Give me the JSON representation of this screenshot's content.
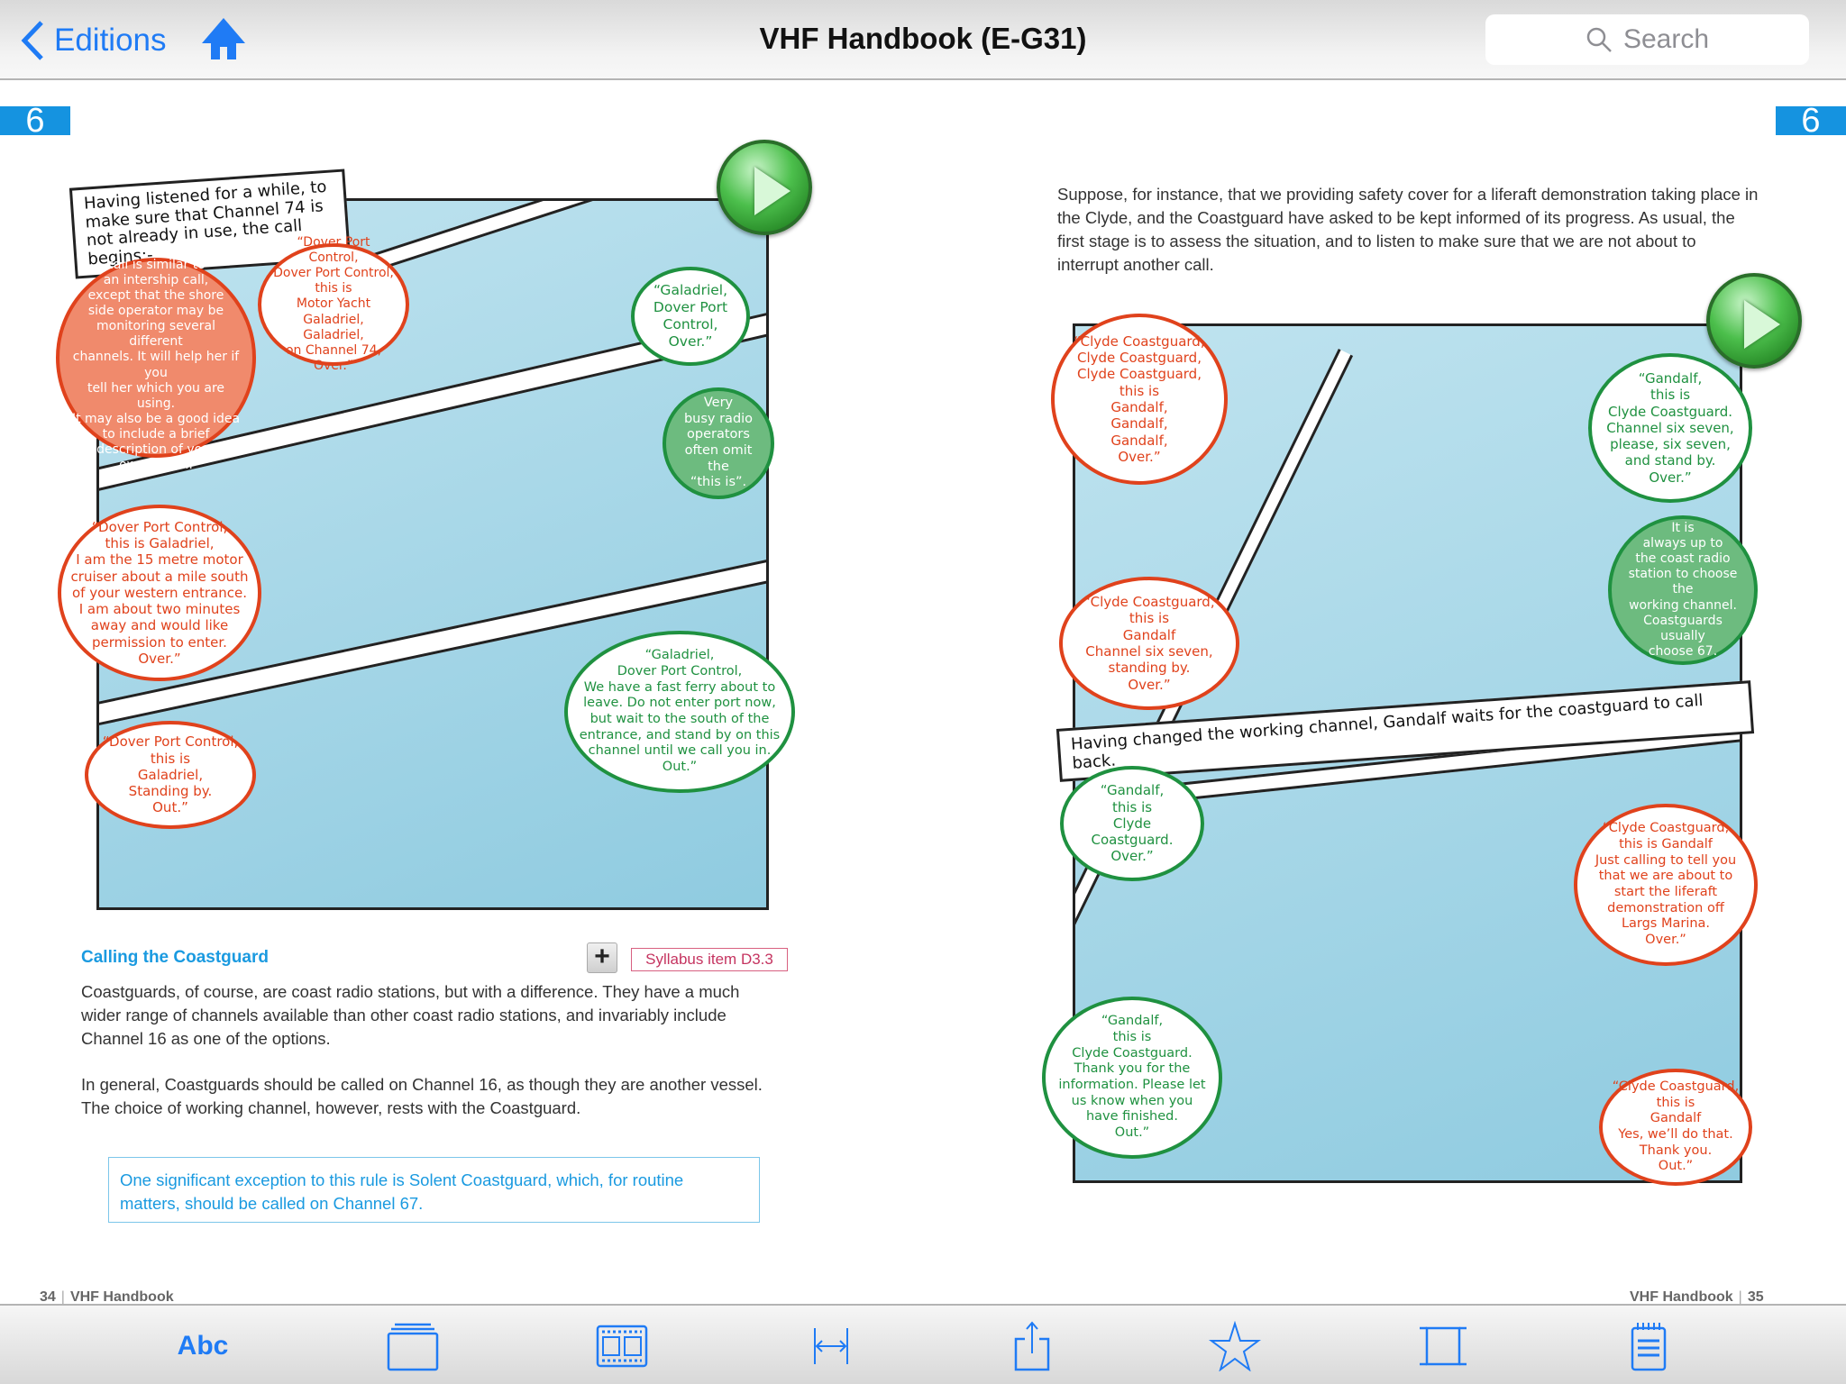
{
  "nav": {
    "back_label": "Editions",
    "back_icon": "chevron-left-icon",
    "home_icon": "home-icon",
    "title": "VHF Handbook (E-G31)",
    "search_placeholder": "Search",
    "accent_color": "#1f7bf5"
  },
  "left_page": {
    "chapter_badge": "6",
    "page_number": "34",
    "footer_title": "VHF Handbook",
    "comic": {
      "caption": "Having listened for a while, to make sure that Channel 74 is not already in use, the call begins:-",
      "note_bubble": "The\ncall is similar to\nan intership call,\nexcept that the shore\nside operator may be\nmonitoring several different\nchannels. It will help her if you\ntell her which you are using.\nIt may also be a good idea\nto include a brief\ndescription of your\nown vessel.",
      "bubble_1": "“Dover Port Control,\nDover Port Control,\nthis is\nMotor Yacht Galadriel,\nGaladriel,\non Channel 74,\nOver.”",
      "bubble_2": "“Galadriel,\nDover Port\nControl,\nOver.”",
      "note_bubble_2": "Very\nbusy radio\noperators\noften omit the\n“this is”.",
      "bubble_3": "“Dover Port Control,\nthis is Galadriel,\nI am the 15 metre motor\ncruiser about a mile south\nof your western entrance.\nI am about two minutes\naway and would like\npermission to enter.\nOver.”",
      "bubble_4": "“Galadriel,\nDover Port Control,\nWe have a fast ferry about to\nleave. Do not enter port now,\nbut wait to the south of the\nentrance, and stand by on this\nchannel until we call you in.\nOut.”",
      "bubble_5": "“Dover Port Control,\nthis is\nGaladriel,\nStanding by.\nOut.”",
      "play_icon": "play-icon"
    },
    "section_heading": "Calling the Coastguard",
    "expand_button": "+",
    "syllabus_label": "Syllabus item D3.3",
    "paragraph_1": "Coastguards, of course, are coast radio stations, but with a difference. They have a much wider range of channels available than other coast radio stations, and invariably include Channel 16 as one of the options.",
    "paragraph_2": "In general, Coastguards should be called on Channel 16, as though they are another vessel. The choice of working channel, however, rests with the Coastguard.",
    "note_box": "One significant exception to this rule is Solent Coastguard, which, for routine matters, should be called on Channel 67."
  },
  "right_page": {
    "chapter_badge": "6",
    "page_number": "35",
    "footer_title": "VHF Handbook",
    "intro": "Suppose, for instance, that we providing safety cover for a liferaft demonstration taking place in the Clyde, and the Coastguard have asked to be kept informed of its progress. As usual, the first stage is to assess the situation, and to listen to make sure that we are not about to interrupt another call.",
    "comic": {
      "bubble_1": "“Clyde Coastguard,\nClyde Coastguard,\nClyde Coastguard,\nthis is\nGandalf,\nGandalf,\nGandalf,\nOver.”",
      "bubble_2": "“Gandalf,\nthis is\nClyde Coastguard.\nChannel six seven,\nplease, six seven,\nand stand by.\nOver.”",
      "note_bubble": "It is\nalways up to\nthe coast radio\nstation to choose the\nworking channel.\nCoastguards usually\nchoose 67.",
      "bubble_3": "“Clyde Coastguard,\nthis is\nGandalf\nChannel six seven,\nstanding by.\nOver.”",
      "caption": "Having changed the working channel, Gandalf waits for the coastguard to call back.",
      "bubble_4": "“Gandalf,\nthis is\nClyde Coastguard.\nOver.”",
      "bubble_5": "“Clyde Coastguard,\nthis is Gandalf\nJust calling to tell you\nthat we are about to\nstart the liferaft\ndemonstration off\nLargs Marina.\nOver.”",
      "bubble_6": "“Gandalf,\nthis is\nClyde Coastguard.\nThank you for the\ninformation. Please let\nus know when you\nhave finished.\nOut.”",
      "bubble_7": "“Clyde Coastguard,\nthis is\nGandalf\nYes, we’ll do that.\nThank you.\nOut.”",
      "play_icon": "play-icon"
    }
  },
  "toolbar": {
    "items": [
      {
        "name": "text-size",
        "label": "Abc"
      },
      {
        "name": "single-page",
        "icon": "single-page-icon"
      },
      {
        "name": "thumbnails",
        "icon": "filmstrip-icon"
      },
      {
        "name": "fit-width",
        "icon": "fit-width-icon"
      },
      {
        "name": "share",
        "icon": "share-icon"
      },
      {
        "name": "bookmark",
        "icon": "star-icon"
      },
      {
        "name": "two-page",
        "icon": "two-page-icon"
      },
      {
        "name": "notes",
        "icon": "notepad-icon"
      }
    ]
  },
  "colors": {
    "chapter_badge": "#1593e0",
    "heading_blue": "#1a9ae0",
    "bubble_red": "#e0421c",
    "bubble_green": "#1f9140",
    "syllabus_pink": "#c53460"
  }
}
